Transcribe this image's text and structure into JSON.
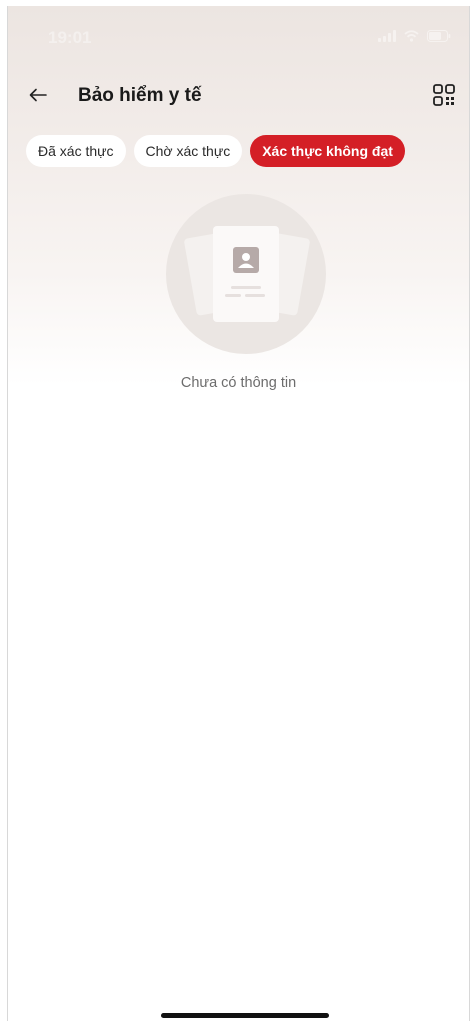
{
  "status_bar": {
    "time": "19:01"
  },
  "header": {
    "title": "Bảo hiểm y tế",
    "back_icon": "arrow-left-icon",
    "qr_icon": "qr-code-icon"
  },
  "tabs": [
    {
      "label": "Đã xác thực",
      "active": false
    },
    {
      "label": "Chờ xác thực",
      "active": false
    },
    {
      "label": "Xác thực không đạt",
      "active": true
    }
  ],
  "empty_state": {
    "message": "Chưa có thông tin",
    "illustration": "id-card-icon"
  },
  "colors": {
    "accent": "#d41f26",
    "title": "#1a1a1a",
    "muted_text": "#6c6c6c"
  }
}
